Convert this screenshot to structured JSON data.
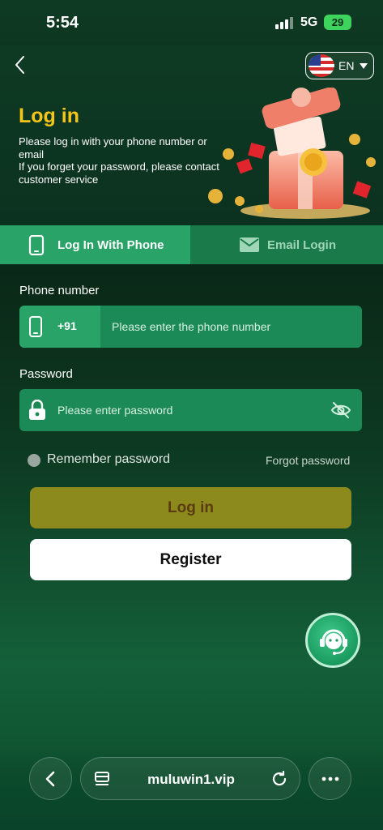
{
  "status_bar": {
    "time": "5:54",
    "network": "5G",
    "battery": "29"
  },
  "header": {
    "language": "EN",
    "title": "Log in",
    "intro_line1": "Please log in with your phone number or email",
    "intro_line2": "If you forget your password, please contact customer service"
  },
  "tabs": [
    {
      "label": "Log In With Phone",
      "icon": "phone-icon",
      "active": true
    },
    {
      "label": "Email Login",
      "icon": "mail-icon",
      "active": false
    }
  ],
  "form": {
    "phone_label": "Phone number",
    "country_code": "+91",
    "phone_placeholder": "Please enter the phone number",
    "password_label": "Password",
    "password_placeholder": "Please enter password",
    "remember_label": "Remember password",
    "forgot_label": "Forgot password",
    "login_label": "Log in",
    "register_label": "Register"
  },
  "browser": {
    "url": "muluwin1.vip"
  },
  "colors": {
    "accent_gold": "#f5c518",
    "tab_active": "#2aa368",
    "field_bg": "#1b8a57",
    "login_btn": "#8d8a1d"
  }
}
